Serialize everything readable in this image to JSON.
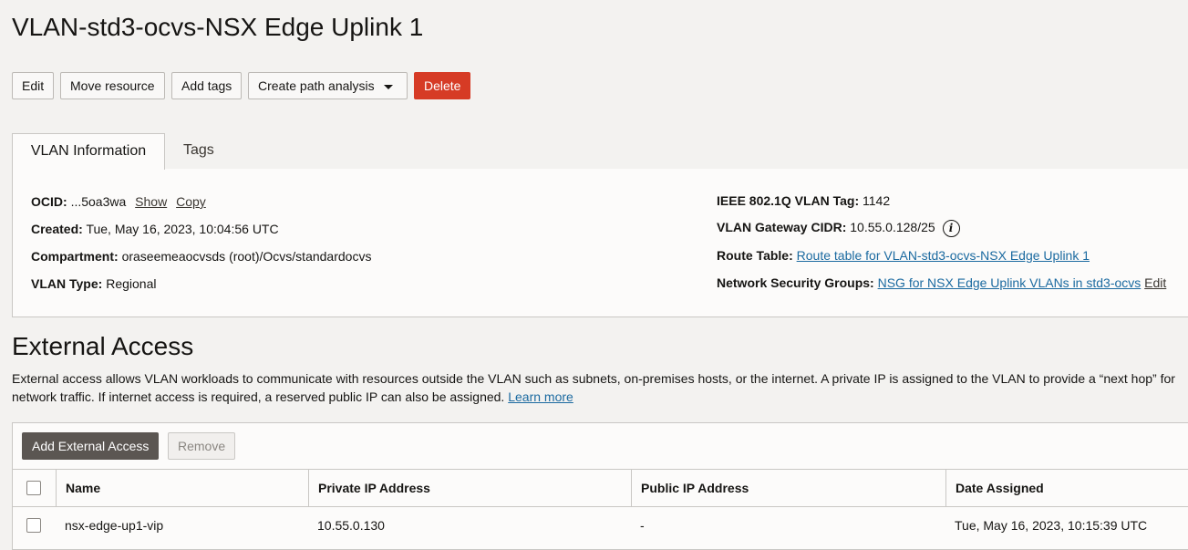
{
  "page": {
    "title": "VLAN-std3-ocvs-NSX Edge Uplink 1"
  },
  "actions": {
    "edit": "Edit",
    "move_resource": "Move resource",
    "add_tags": "Add tags",
    "create_path_analysis": "Create path analysis",
    "delete": "Delete"
  },
  "tabs": [
    {
      "label": "VLAN Information",
      "active": true
    },
    {
      "label": "Tags",
      "active": false
    }
  ],
  "vlan_info": {
    "ocid_label": "OCID:",
    "ocid_value": "...5oa3wa",
    "show_link": "Show",
    "copy_link": "Copy",
    "created_label": "Created:",
    "created_value": "Tue, May 16, 2023, 10:04:56 UTC",
    "compartment_label": "Compartment:",
    "compartment_value": "oraseemeaocvsds (root)/Ocvs/standardocvs",
    "vlan_type_label": "VLAN Type:",
    "vlan_type_value": "Regional",
    "vlan_tag_label": "IEEE 802.1Q VLAN Tag:",
    "vlan_tag_value": "1142",
    "gateway_cidr_label": "VLAN Gateway CIDR:",
    "gateway_cidr_value": "10.55.0.128/25",
    "route_table_label": "Route Table:",
    "route_table_value": "Route table for VLAN-std3-ocvs-NSX Edge Uplink 1",
    "nsg_label": "Network Security Groups:",
    "nsg_value": "NSG for NSX Edge Uplink VLANs in std3-ocvs",
    "nsg_edit": "Edit"
  },
  "external_access": {
    "title": "External Access",
    "description": "External access allows VLAN workloads to communicate with resources outside the VLAN such as subnets, on-premises hosts, or the internet. A private IP is assigned to the VLAN to provide a “next hop” for network traffic. If internet access is required, a reserved public IP can also be assigned.",
    "learn_more": "Learn more",
    "add_button": "Add External Access",
    "remove_button": "Remove",
    "columns": [
      "Name",
      "Private IP Address",
      "Public IP Address",
      "Date Assigned"
    ],
    "rows": [
      [
        "nsx-edge-up1-vip",
        "10.55.0.130",
        "-",
        "Tue, May 16, 2023, 10:15:39 UTC"
      ]
    ]
  },
  "colors": {
    "danger": "#d63b25",
    "link": "#1b6aa0",
    "primary_button": "#5b5652"
  }
}
